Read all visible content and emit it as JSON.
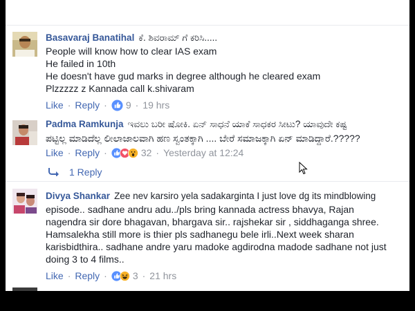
{
  "comments": [
    {
      "author": "Basavaraj Banatihal",
      "inline": "ಕೆ. ಶಿವರಾಮ್ ಗೆ ಕರಿಸಿ.....",
      "lines": [
        "People will know how to clear IAS exam",
        "He failed in 10th",
        "He doesn't have gud marks in degree although he cleared exam",
        "Plzzzzz z Kannada call k.shivaram"
      ],
      "like": "Like",
      "reply": "Reply",
      "reactions": "9",
      "time": "19 hrs"
    },
    {
      "author": "Padma Ramkunja",
      "inline": "ಇವಲು ಬರೀ ಷೋಕಿ. ಏನ್ ಸಾಧನೆ ಯಾಕೆ ಸಾಧಕರ ಸೀಟು? ಯಾವುದೇ ಕಷ್ಟ",
      "lines": [
        "ಪಟ್ಟಿಲ್ಲ ಮಾಡಿದೆಲ್ಲ ಲೀಲಾಜಾಲವಾಗಿ ಹಣ ಸ್ವಂತಕ್ಕಾಗಿ .... ಬೇರೆ ಸಮಾಜಕ್ಕಾಗಿ ಏನ್ ಮಾಡಿದ್ದಾರೆ.?????"
      ],
      "like": "Like",
      "reply": "Reply",
      "reactions": "32",
      "time": "Yesterday at 12:24",
      "replies_link": "1 Reply"
    },
    {
      "author": "Divya Shankar",
      "inline": "Zee nev karsiro yela sadakarginta I just love dg its mindblowing",
      "lines": [
        "episode.. sadhane andru adu../pls bring kannada actress bhavya, Rajan",
        "nagendra sir dore bhagavan, bhargava sir.. rajshekar sir , siddhaganga shree.",
        "Hamsalekha still more is thier pls sadhanegu bele irli..Next week sharan",
        "karisbidthira.. sadhane andre yaru madoke agdirodna madode sadhane not just",
        "doing 3 to 4 films.."
      ],
      "like": "Like",
      "reply": "Reply",
      "reactions": "3",
      "time": "21 hrs"
    }
  ],
  "colors": {
    "link": "#4267b2",
    "author": "#365899",
    "meta": "#90949c",
    "text": "#1d2129",
    "like_blue": "#5890ff",
    "haha_yellow": "#f7b125",
    "love_red": "#f25268"
  },
  "icons": [
    "like-reaction-icon",
    "love-reaction-icon",
    "wow-reaction-icon",
    "haha-reaction-icon",
    "reply-arrow-icon",
    "mouse-cursor-icon"
  ]
}
